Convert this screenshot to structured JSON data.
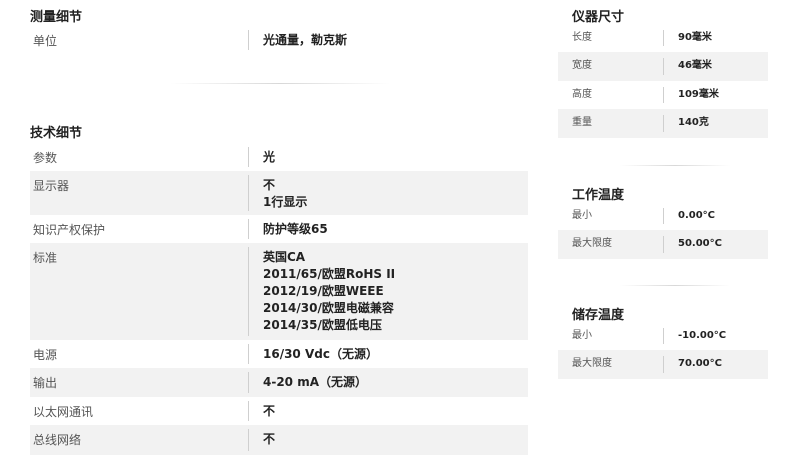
{
  "measurement": {
    "title": "测量细节",
    "rows": [
      {
        "label": "单位",
        "value": [
          "光通量，勒克斯"
        ]
      }
    ]
  },
  "technical": {
    "title": "技术细节",
    "rows": [
      {
        "label": "参数",
        "value": [
          "光"
        ]
      },
      {
        "label": "显示器",
        "value": [
          "不",
          "1行显示"
        ]
      },
      {
        "label": "知识产权保护",
        "value": [
          "防护等级65"
        ]
      },
      {
        "label": "标准",
        "value": [
          "英国CA",
          "2011/65/欧盟RoHS II",
          "2012/19/欧盟WEEE",
          "2014/30/欧盟电磁兼容",
          "2014/35/欧盟低电压"
        ]
      },
      {
        "label": "电源",
        "value": [
          "16/30 Vdc（无源）"
        ]
      },
      {
        "label": "输出",
        "value": [
          "4-20 mA（无源）"
        ]
      },
      {
        "label": "以太网通讯",
        "value": [
          "不"
        ]
      },
      {
        "label": "总线网络",
        "value": [
          "不"
        ]
      }
    ]
  },
  "dimensions": {
    "title": "仪器尺寸",
    "rows": [
      {
        "label": "长度",
        "value": "90毫米"
      },
      {
        "label": "宽度",
        "value": "46毫米"
      },
      {
        "label": "高度",
        "value": "109毫米"
      },
      {
        "label": "重量",
        "value": "140克"
      }
    ]
  },
  "operating_temp": {
    "title": "工作温度",
    "rows": [
      {
        "label": "最小",
        "value": "0.00°C"
      },
      {
        "label": "最大限度",
        "value": "50.00°C"
      }
    ]
  },
  "storage_temp": {
    "title": "储存温度",
    "rows": [
      {
        "label": "最小",
        "value": "-10.00°C"
      },
      {
        "label": "最大限度",
        "value": "70.00°C"
      }
    ]
  }
}
